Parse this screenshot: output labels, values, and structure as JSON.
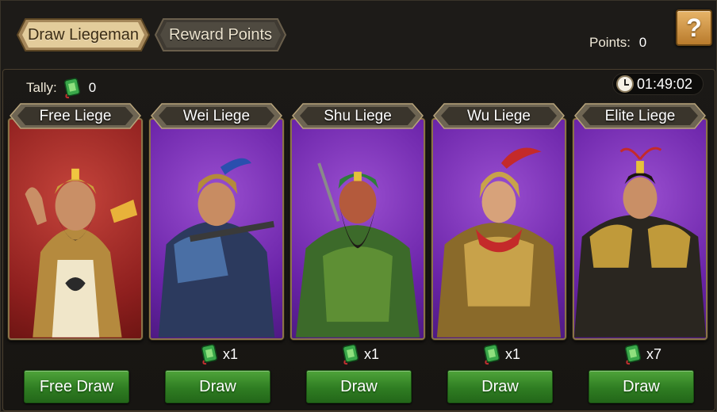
{
  "tabs": [
    {
      "label": "Draw Liegeman",
      "active": true
    },
    {
      "label": "Reward Points",
      "active": false
    }
  ],
  "help": {
    "label": "?"
  },
  "points": {
    "label": "Points:",
    "value": "0"
  },
  "tally": {
    "label": "Tally:",
    "value": "0",
    "icon": "jade-tally-icon"
  },
  "timer": {
    "value": "01:49:02",
    "icon": "clock-icon"
  },
  "cards": [
    {
      "title": "Free Liege",
      "button": "Free Draw",
      "cost": ""
    },
    {
      "title": "Wei Liege",
      "button": "Draw",
      "cost": "x1"
    },
    {
      "title": "Shu Liege",
      "button": "Draw",
      "cost": "x1"
    },
    {
      "title": "Wu Liege",
      "button": "Draw",
      "cost": "x1"
    },
    {
      "title": "Elite Liege",
      "button": "Draw",
      "cost": "x7"
    }
  ],
  "colors": {
    "free_card": "#8e1f1e",
    "purple_card": "#6a23a8",
    "button_green": "#2f7d22",
    "tab_active": "#d9c08a",
    "accent_gold": "#c9a45a"
  }
}
